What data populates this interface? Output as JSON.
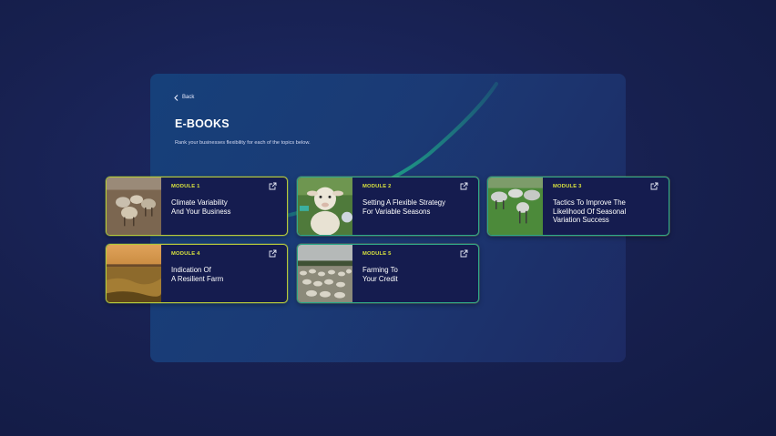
{
  "nav": {
    "back_label": "Back"
  },
  "header": {
    "title": "E-BOOKS",
    "subtitle": "Rank your businesses flexibility for each of the topics below."
  },
  "colors": {
    "accent_module": "#d9e33e",
    "card_border": "#2ea889",
    "card_bg": "#151c4f",
    "swoosh": "#1fb58a"
  },
  "modules": [
    {
      "module_label": "MODULE 1",
      "title_line1": "Climate Variability",
      "title_line2": "And Your Business",
      "title_line3": "",
      "image": "sheep-in-dry-field",
      "icon": "external-link-icon"
    },
    {
      "module_label": "MODULE 2",
      "title_line1": "Setting A Flexible Strategy",
      "title_line2": "For Variable Seasons",
      "title_line3": "",
      "image": "lamb-closeup",
      "icon": "external-link-icon"
    },
    {
      "module_label": "MODULE 3",
      "title_line1": "Tactics To Improve The",
      "title_line2": "Likelihood Of Seasonal",
      "title_line3": "Variation Success",
      "image": "sheep-on-green-grass",
      "icon": "external-link-icon"
    },
    {
      "module_label": "MODULE 4",
      "title_line1": "Indication Of",
      "title_line2": "A Resilient Farm",
      "title_line3": "",
      "image": "golden-field-sunset",
      "icon": "external-link-icon"
    },
    {
      "module_label": "MODULE 5",
      "title_line1": "Farming To",
      "title_line2": "Your Credit",
      "title_line3": "",
      "image": "sheep-flock-paddock",
      "icon": "external-link-icon"
    }
  ]
}
